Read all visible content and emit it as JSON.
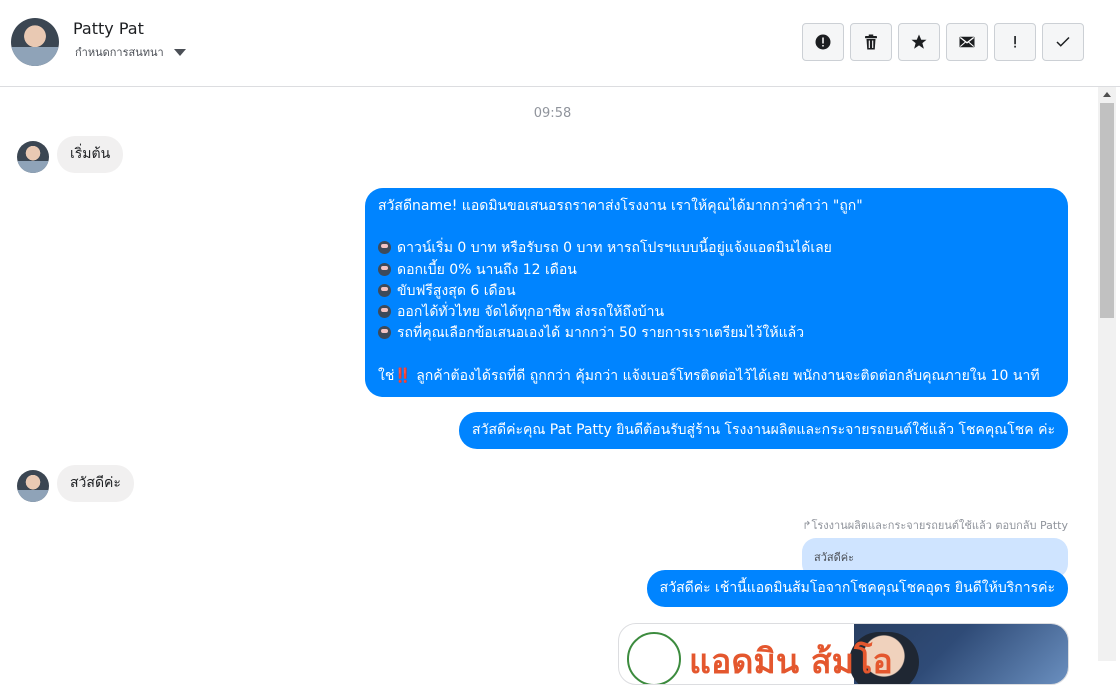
{
  "header": {
    "name": "Patty Pat",
    "subtitle": "กำหนดการสนทนา",
    "actions": [
      {
        "icon": "alert-circle-icon",
        "label": "alert"
      },
      {
        "icon": "trash-icon",
        "label": "delete"
      },
      {
        "icon": "star-icon",
        "label": "star"
      },
      {
        "icon": "envelope-icon",
        "label": "mail"
      },
      {
        "icon": "exclamation-icon",
        "label": "!"
      },
      {
        "icon": "check-icon",
        "label": "done"
      }
    ]
  },
  "conversation": {
    "timestamp": "09:58",
    "messages": {
      "m1": "เริ่มต้น",
      "m2_lines": [
        "สวัสดีname! แอดมินขอเสนอรถราคาส่งโรงงาน เราให้คุณได้มากกว่าคำว่า \"ถูก\"",
        "",
        "ดาวน์เริ่ม 0 บาท หรือรับรถ 0 บาท หารถโปรฯแบบนี้อยู่แจ้งแอดมินได้เลย",
        "ดอกเบี้ย 0% นานถึง 12 เดือน",
        "ขับฟรีสูงสุด 6 เดือน",
        "ออกได้ทั่วไทย จัดได้ทุกอาชีพ ส่งรถให้ถึงบ้าน",
        "รถที่คุณเลือกข้อเสนอเองได้ มากกว่า 50 รายการเราเตรียมไว้ให้แล้ว",
        "",
        "ใช่‼️ ลูกค้าต้องได้รถที่ดี ถูกกว่า คุ้มกว่า แจ้งเบอร์โทรติดต่อไว้ได้เลย พนักงานจะติดต่อกลับคุณภายใน 10 นาที"
      ],
      "m3": "สวัสดีค่ะคุณ Pat Patty ยินดีต้อนรับสู่ร้าน โรงงานผลิตและกระจายรถยนต์ใช้แล้ว โชคคุณโชค ค่ะ",
      "m4": "สวัสดีค่ะ",
      "reply_meta": "↱โรงงานผลิตและกระจายรถยนต์ใช้แล้ว ตอบกลับ Patty",
      "quoted": "สวัสดีค่ะ",
      "m5": "สวัสดีค่ะ เช้านี้แอดมินส้มโอจากโชคคุณโชคอุดร ยินดีให้บริการค่ะ",
      "image_text": "แอดมิน ส้มโอ"
    }
  },
  "colors": {
    "outgoing": "#0084ff",
    "incoming": "#f1f0f0",
    "quote": "#cfe4ff"
  }
}
